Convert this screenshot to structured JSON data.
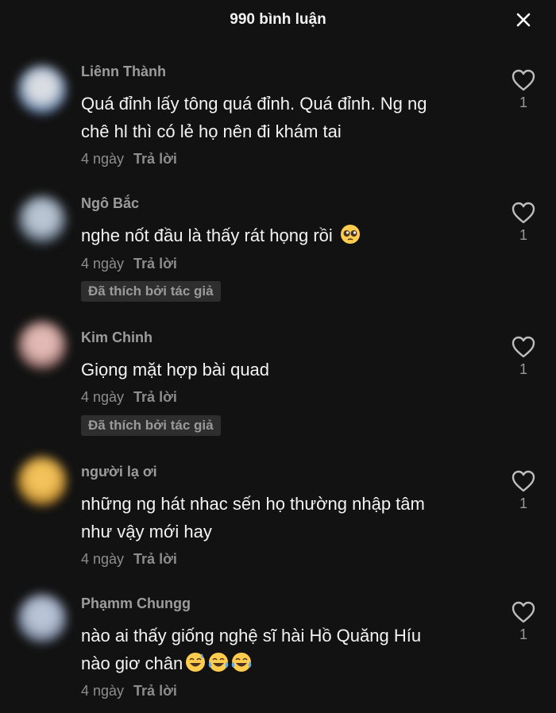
{
  "header": {
    "title": "990 bình luận"
  },
  "comments": [
    {
      "user": "Liênn Thành",
      "lines": [
        "Quá đỉnh lấy tông quá đỉnh. Quá đỉnh. Ng ng",
        "chê hl thì có lẻ họ nên đi khám tai"
      ],
      "time": "4 ngày",
      "reply": "Trả lời",
      "likes": "1",
      "avatar_colors": [
        "#d9dde3",
        "#3e5f8c"
      ]
    },
    {
      "user": "Ngô Bắc",
      "lines": [
        "nghe nốt đầu là thấy rát họng rồi"
      ],
      "emoji": "pleading-face-emoji",
      "time": "4 ngày",
      "reply": "Trả lời",
      "likes": "1",
      "liked_badge": "Đã thích bởi tác giả",
      "avatar_colors": [
        "#b8c4d2",
        "#33404f"
      ]
    },
    {
      "user": "Kim Chinh",
      "lines": [
        "Giọng mặt hợp bài quad"
      ],
      "time": "4 ngày",
      "reply": "Trả lời",
      "likes": "1",
      "liked_badge": "Đã thích bởi tác giả",
      "avatar_colors": [
        "#e2b9b4",
        "#6b4a47"
      ]
    },
    {
      "user": "người lạ ơi",
      "lines": [
        "những ng hát nhac sến họ thường nhập tâm",
        "như vậy mới hay"
      ],
      "time": "4 ngày",
      "reply": "Trả lời",
      "likes": "1",
      "avatar_colors": [
        "#f3c25a",
        "#9a6a1c"
      ]
    },
    {
      "user": "Phạmm Chungg",
      "lines": [
        "nào ai thấy giống nghệ sĩ hài Hồ Quăng Híu",
        "nào giơ chân"
      ],
      "emojis_line2": [
        "grinning-sweat-emoji",
        "tears-of-joy-emoji",
        "tears-of-joy-emoji"
      ],
      "time": "4 ngày",
      "reply": "Trả lời",
      "likes": "1",
      "avatar_colors": [
        "#b9c3d6",
        "#55627a"
      ]
    }
  ]
}
